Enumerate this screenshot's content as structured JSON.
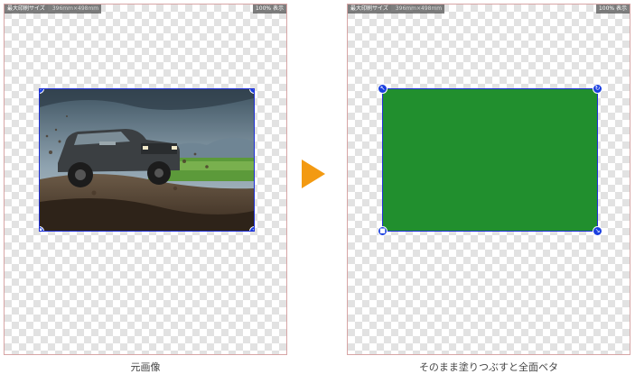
{
  "left_panel": {
    "status": {
      "label": "最大印刷サイズ",
      "size": "396mm×498mm",
      "zoom": "100% 表示"
    },
    "layer": {
      "type": "photo",
      "subject": "off-road-suv-in-mud"
    },
    "caption": "元画像"
  },
  "right_panel": {
    "status": {
      "label": "最大印刷サイズ",
      "size": "396mm×498mm",
      "zoom": "100% 表示"
    },
    "layer": {
      "type": "solid-fill",
      "fill_color": "#218f2e"
    },
    "caption": "そのまま塗りつぶすと全面ベタ"
  },
  "arrow": {
    "icon": "play-arrow-icon",
    "color": "#f39a12"
  },
  "handles": {
    "top_left": "resize-icon",
    "top_right": "rotate-icon",
    "bottom_left": "trash-icon",
    "bottom_right": "resize-icon"
  },
  "colors": {
    "handle": "#1a3fe0",
    "selection_border": "#1f2fd8",
    "panel_border": "#d7a5a5"
  }
}
